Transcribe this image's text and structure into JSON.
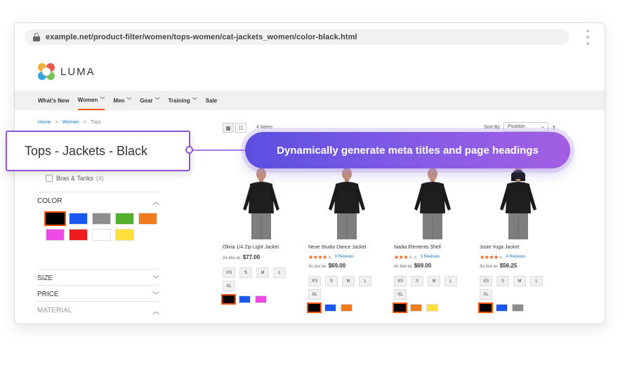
{
  "browser": {
    "url": "example.net/product-filter/women/tops-women/cat-jackets_women/color-black.html"
  },
  "header": {
    "logo_text": "LUMA"
  },
  "nav": {
    "items": [
      {
        "label": "What's New",
        "chevron": false,
        "active": false
      },
      {
        "label": "Women",
        "chevron": true,
        "active": true
      },
      {
        "label": "Men",
        "chevron": true,
        "active": false
      },
      {
        "label": "Gear",
        "chevron": true,
        "active": false
      },
      {
        "label": "Training",
        "chevron": true,
        "active": false
      },
      {
        "label": "Sale",
        "chevron": false,
        "active": false
      }
    ]
  },
  "breadcrumb": {
    "home": "Home",
    "sep1": ">",
    "women": "Women",
    "sep2": ">",
    "current": "Tops"
  },
  "toolbar": {
    "item_count": "4 Items",
    "sort_label": "Sort By",
    "sort_value": "Position"
  },
  "sidebar": {
    "bras_label": "Bras & Tanks",
    "bras_count": "(4)",
    "color_title": "COLOR",
    "size_title": "SIZE",
    "price_title": "PRICE",
    "material_title": "MATERIAL",
    "color_swatches": [
      "#000000",
      "#1a56f0",
      "#8c8c8c",
      "#53b02e",
      "#f07b1c",
      "#ef48e8",
      "#ee1d1d",
      "#ffffff",
      "#ffe03a"
    ],
    "selected_color": "#000000"
  },
  "callout": {
    "text": "Tops - Jackets - Black"
  },
  "banner": {
    "text": "Dynamically generate meta titles and page headings"
  },
  "products": [
    {
      "name": "Olivia 1/4 Zip Light Jacket",
      "rating": 0,
      "reviews": "",
      "price_prefix": "As low as",
      "price": "$77.00",
      "sizes": [
        "XS",
        "S",
        "M",
        "L",
        "XL"
      ],
      "colors": [
        "#000000",
        "#1a56f0",
        "#ef48e8"
      ]
    },
    {
      "name": "Neve Studio Dance Jacket",
      "rating": 4,
      "reviews": "3 Reviews",
      "price_prefix": "As low as",
      "price": "$69.00",
      "sizes": [
        "XS",
        "S",
        "M",
        "L",
        "XL"
      ],
      "colors": [
        "#000000",
        "#1a56f0",
        "#f07b1c"
      ]
    },
    {
      "name": "Nadia Elements Shell",
      "rating": 3,
      "reviews": "3 Reviews",
      "price_prefix": "As low as",
      "price": "$69.00",
      "sizes": [
        "XS",
        "S",
        "M",
        "L",
        "XL"
      ],
      "colors": [
        "#000000",
        "#f07b1c",
        "#ffe03a"
      ]
    },
    {
      "name": "Josie Yoga Jacket",
      "rating": 3.5,
      "reviews": "4 Reviews",
      "price_prefix": "As low as",
      "price": "$56.25",
      "sizes": [
        "XS",
        "S",
        "M",
        "L",
        "XL"
      ],
      "colors": [
        "#000000",
        "#1a56f0",
        "#8c8c8c"
      ]
    }
  ],
  "colors": {
    "accent": "#ff5501",
    "link": "#1979c3",
    "callout_border": "#8c55d9"
  }
}
